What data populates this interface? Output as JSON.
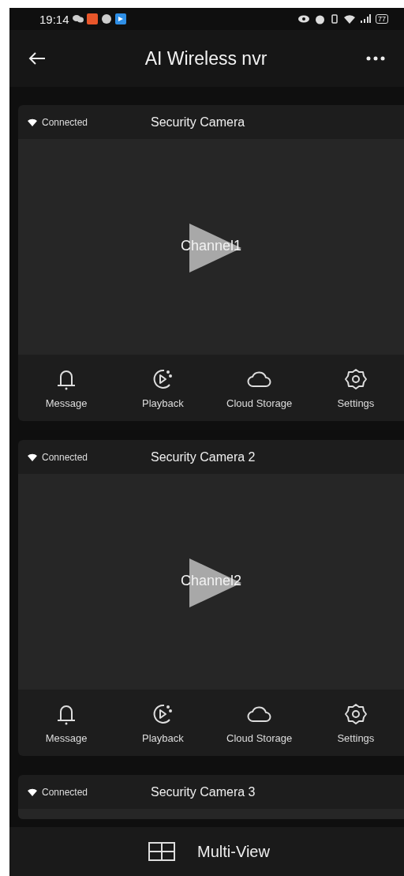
{
  "status_bar": {
    "time": "19:14",
    "battery": "77"
  },
  "header": {
    "title": "AI Wireless nvr"
  },
  "cameras": [
    {
      "status": "Connected",
      "name": "Security Camera",
      "channel": "Channel1",
      "actions": [
        {
          "kind": "message",
          "label": "Message"
        },
        {
          "kind": "playback",
          "label": "Playback"
        },
        {
          "kind": "cloud",
          "label": "Cloud Storage"
        },
        {
          "kind": "settings",
          "label": "Settings"
        }
      ]
    },
    {
      "status": "Connected",
      "name": "Security Camera 2",
      "channel": "Channel2",
      "actions": [
        {
          "kind": "message",
          "label": "Message"
        },
        {
          "kind": "playback",
          "label": "Playback"
        },
        {
          "kind": "cloud",
          "label": "Cloud Storage"
        },
        {
          "kind": "settings",
          "label": "Settings"
        }
      ]
    },
    {
      "status": "Connected",
      "name": "Security Camera 3"
    }
  ],
  "bottom_bar": {
    "label": "Multi-View"
  }
}
